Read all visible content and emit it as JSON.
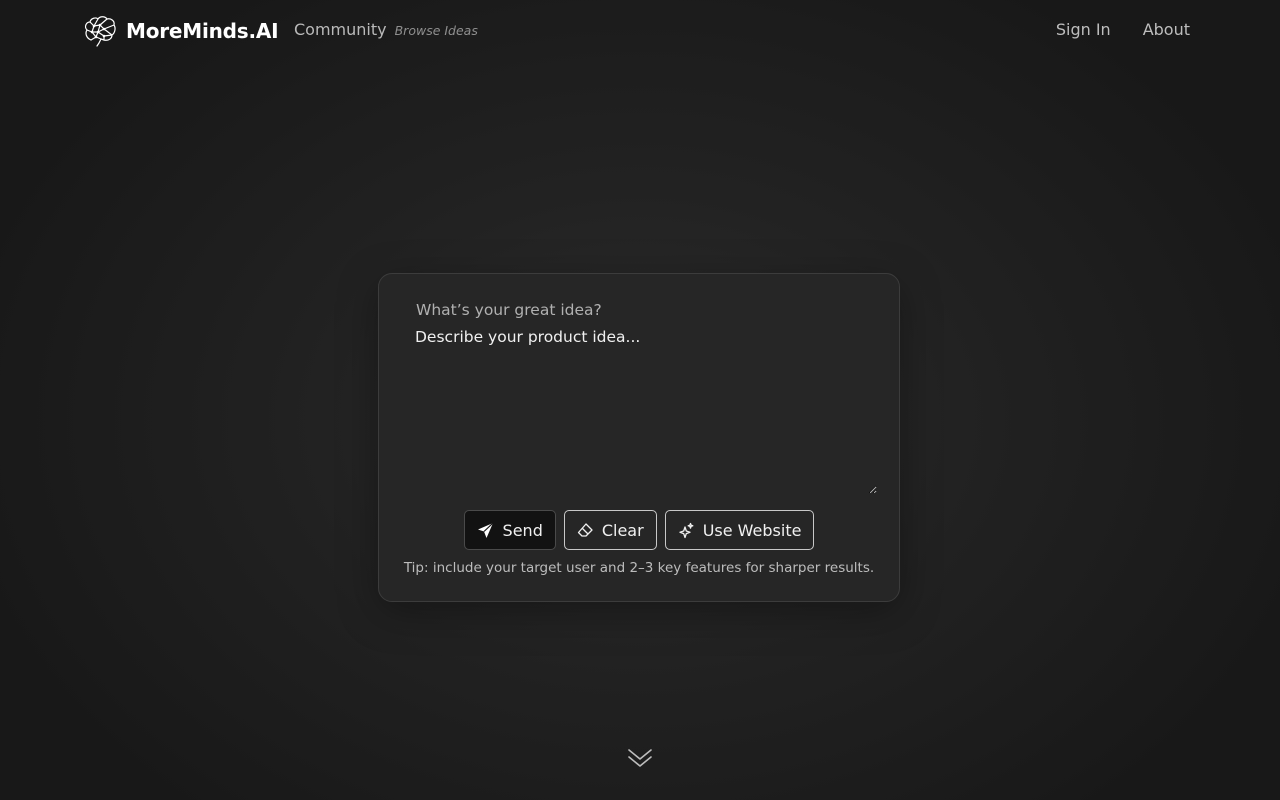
{
  "header": {
    "brand_name": "MoreMinds.AI",
    "brand_icon": "brain-icon",
    "community_label": "Community",
    "community_sublabel": "Browse Ideas",
    "nav": {
      "sign_in": "Sign In",
      "about": "About"
    }
  },
  "composer": {
    "question": "What’s your great idea?",
    "input_placeholder": "Describe your product idea...",
    "input_value": "",
    "buttons": {
      "send": {
        "label": "Send",
        "icon": "send-icon"
      },
      "clear": {
        "label": "Clear",
        "icon": "eraser-icon"
      },
      "use_website": {
        "label": "Use Website",
        "icon": "sparkle-icon"
      }
    },
    "tip": "Tip: include your target user and 2–3 key features for sharper results."
  },
  "scroll_hint": {
    "icon": "double-chevron-down-icon"
  },
  "colors": {
    "background": "#1f1f1f",
    "card": "#262626",
    "text": "#f0f0f0",
    "muted": "#b0b0b0"
  }
}
